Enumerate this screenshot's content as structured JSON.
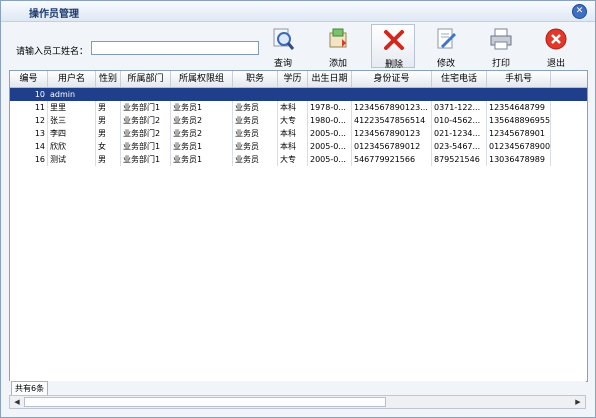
{
  "window": {
    "title": "操作员管理"
  },
  "search": {
    "label": "请输入员工姓名：",
    "value": ""
  },
  "toolbar": {
    "query": "查询",
    "add": "添加",
    "delete": "删除",
    "edit": "修改",
    "print": "打印",
    "exit": "退出"
  },
  "table": {
    "columns": [
      "编号",
      "用户名",
      "性别",
      "所属部门",
      "所属权限组",
      "职务",
      "学历",
      "出生日期",
      "身份证号",
      "住宅电话",
      "手机号"
    ],
    "rows": [
      [
        "10",
        "admin",
        "",
        "",
        "",
        "",
        "",
        "",
        "",
        "",
        ""
      ],
      [
        "11",
        "里里",
        "男",
        "业务部门1",
        "业务员1",
        "业务员",
        "本科",
        "1978-0...",
        "1234567890123...",
        "0371-122...",
        "12354648799"
      ],
      [
        "12",
        "张三",
        "男",
        "业务部门2",
        "业务员2",
        "业务员",
        "大专",
        "1980-0...",
        "41223547856514",
        "010-4562...",
        "135648896955"
      ],
      [
        "13",
        "李四",
        "男",
        "业务部门2",
        "业务员2",
        "业务员",
        "本科",
        "2005-0...",
        "1234567890123",
        "021-1234...",
        "12345678901"
      ],
      [
        "14",
        "欣欣",
        "女",
        "业务部门1",
        "业务员1",
        "业务员",
        "本科",
        "2005-0...",
        "0123456789012",
        "023-5467...",
        "012345678900"
      ],
      [
        "16",
        "测试",
        "男",
        "业务部门1",
        "业务员1",
        "业务员",
        "大专",
        "2005-0...",
        "546779921566",
        "879521546",
        "13036478989"
      ]
    ],
    "selected_index": 0
  },
  "footer": {
    "count": "共有6条"
  },
  "icons": {
    "query": "magnifier-icon",
    "add": "add-icon",
    "delete": "red-x-icon",
    "edit": "edit-document-icon",
    "print": "printer-icon",
    "exit": "red-close-icon"
  }
}
